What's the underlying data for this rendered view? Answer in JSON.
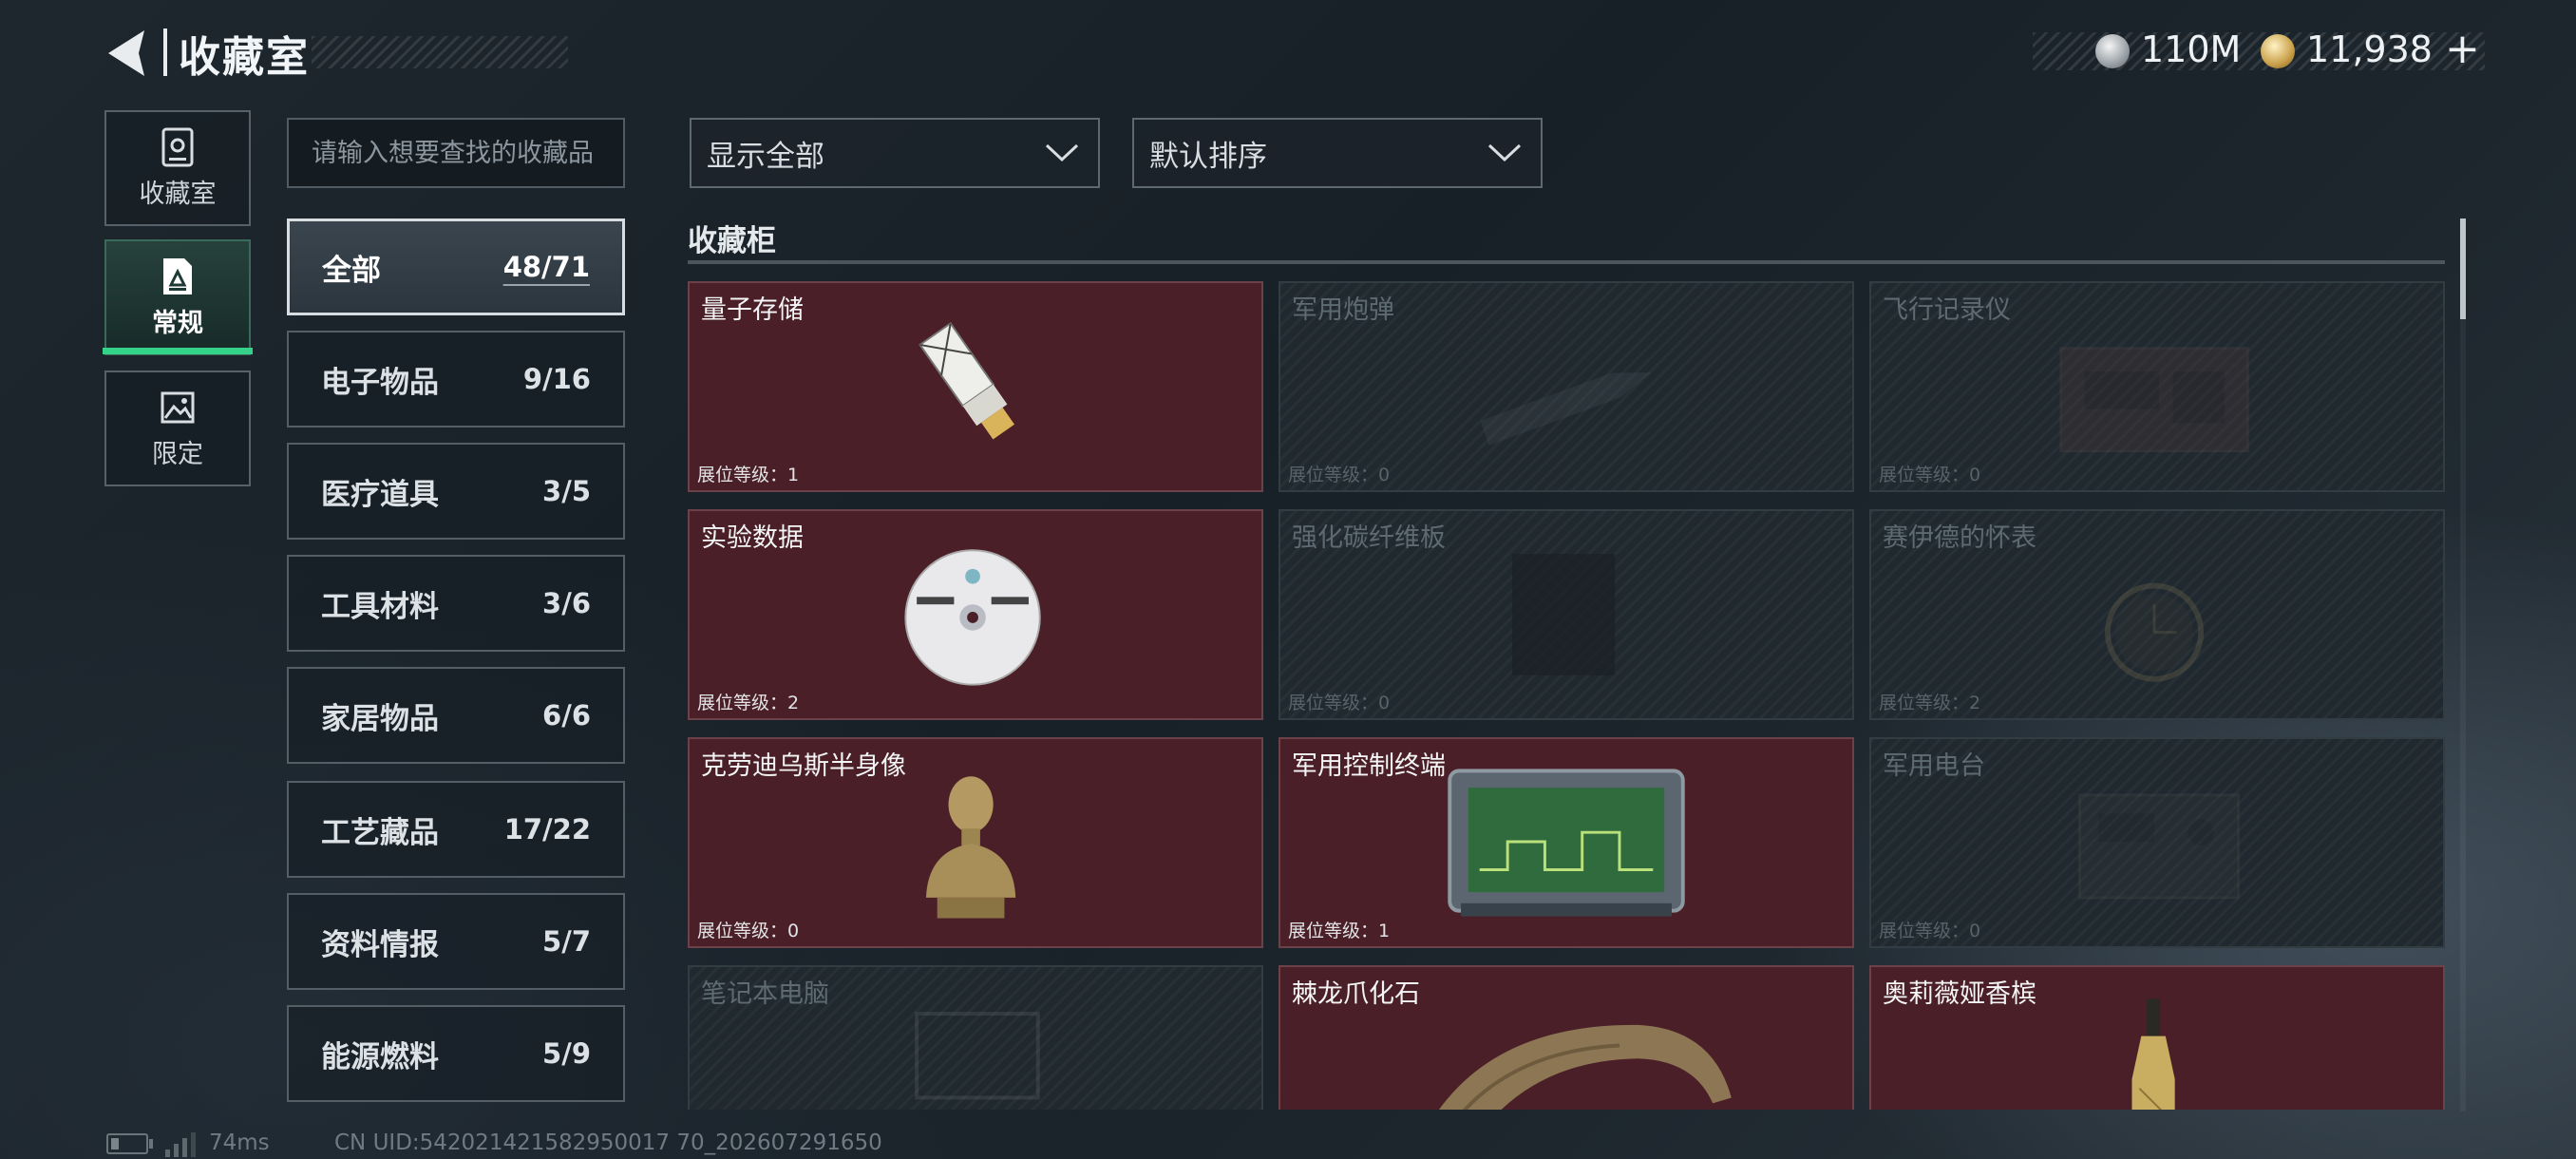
{
  "header": {
    "title": "收藏室",
    "currencies": [
      {
        "icon": "silver-coin-icon",
        "amount": "110M"
      },
      {
        "icon": "gold-coin-icon",
        "amount": "11,938"
      }
    ],
    "add_label": "+"
  },
  "side_tabs": [
    {
      "label": "收藏室",
      "icon": "vault-door-icon",
      "active": false
    },
    {
      "label": "常规",
      "icon": "document-icon",
      "active": true
    },
    {
      "label": "限定",
      "icon": "limited-image-icon",
      "active": false
    }
  ],
  "search": {
    "placeholder": "请输入想要查找的收藏品",
    "value": ""
  },
  "categories": [
    {
      "name": "全部",
      "count": "48/71",
      "active": true
    },
    {
      "name": "电子物品",
      "count": "9/16"
    },
    {
      "name": "医疗道具",
      "count": "3/5"
    },
    {
      "name": "工具材料",
      "count": "3/6"
    },
    {
      "name": "家居物品",
      "count": "6/6"
    },
    {
      "name": "工艺藏品",
      "count": "17/22"
    },
    {
      "name": "资料情报",
      "count": "5/7"
    },
    {
      "name": "能源燃料",
      "count": "5/9"
    }
  ],
  "filters": {
    "display": "显示全部",
    "sort": "默认排序"
  },
  "section_title": "收藏柜",
  "level_prefix": "展位等级：",
  "items": [
    {
      "name": "量子存储",
      "level": "1",
      "owned": true,
      "art": "usb-drive-icon"
    },
    {
      "name": "军用炮弹",
      "level": "0",
      "owned": false,
      "art": "artillery-shell-icon"
    },
    {
      "name": "飞行记录仪",
      "level": "0",
      "owned": false,
      "art": "flight-recorder-icon"
    },
    {
      "name": "实验数据",
      "level": "2",
      "owned": true,
      "art": "data-disc-icon"
    },
    {
      "name": "强化碳纤维板",
      "level": "0",
      "owned": false,
      "art": "carbon-plate-icon"
    },
    {
      "name": "赛伊德的怀表",
      "level": "2",
      "owned": false,
      "art": "pocket-watch-icon"
    },
    {
      "name": "克劳迪乌斯半身像",
      "level": "0",
      "owned": true,
      "art": "bust-statue-icon"
    },
    {
      "name": "军用控制终端",
      "level": "1",
      "owned": true,
      "art": "control-terminal-icon"
    },
    {
      "name": "军用电台",
      "level": "0",
      "owned": false,
      "art": "military-radio-icon"
    },
    {
      "name": "笔记本电脑",
      "level": "",
      "owned": false,
      "art": "laptop-icon"
    },
    {
      "name": "棘龙爪化石",
      "level": "",
      "owned": true,
      "art": "claw-fossil-icon"
    },
    {
      "name": "奥莉薇娅香槟",
      "level": "",
      "owned": true,
      "art": "champagne-bottle-icon"
    }
  ],
  "footer": {
    "ping": "74ms",
    "uid": "CN UID:542021421582950017 70_202607291650"
  }
}
